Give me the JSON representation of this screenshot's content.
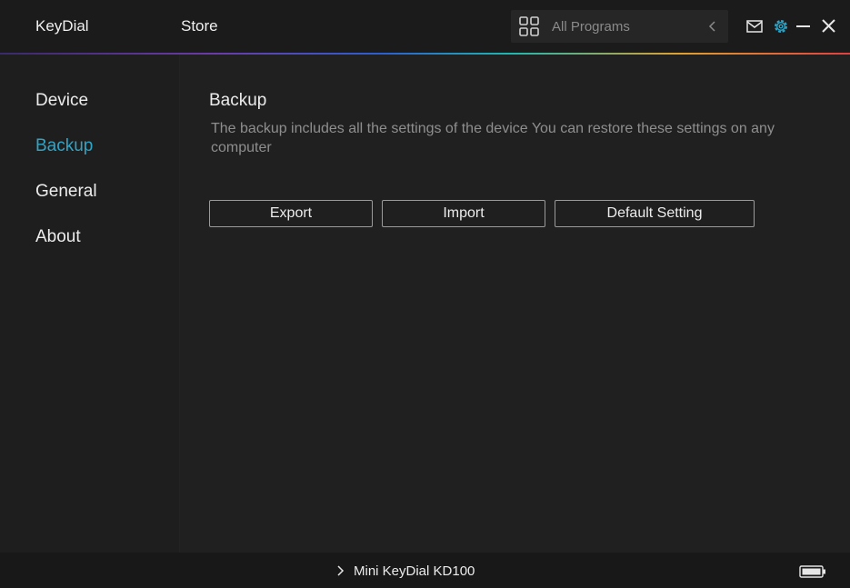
{
  "header": {
    "brand": "KeyDial",
    "store_tab": "Store",
    "program_select": {
      "label": "All Programs",
      "icon": "grid-icon"
    },
    "window_icons": [
      "mail-icon",
      "gear-icon",
      "minimize-icon",
      "close-icon"
    ]
  },
  "sidebar": {
    "items": [
      {
        "label": "Device",
        "active": false
      },
      {
        "label": "Backup",
        "active": true
      },
      {
        "label": "General",
        "active": false
      },
      {
        "label": "About",
        "active": false
      }
    ]
  },
  "main": {
    "title": "Backup",
    "description": "The backup includes all the settings of the device You can restore these settings  on any computer",
    "buttons": {
      "export": "Export",
      "import": "Import",
      "default": "Default Setting"
    }
  },
  "footer": {
    "device_name": "Mini KeyDial KD100",
    "battery_icon": "battery-icon"
  },
  "colors": {
    "accent": "#2ea5c7",
    "background": "#202020",
    "topbar": "#1b1b1b"
  }
}
